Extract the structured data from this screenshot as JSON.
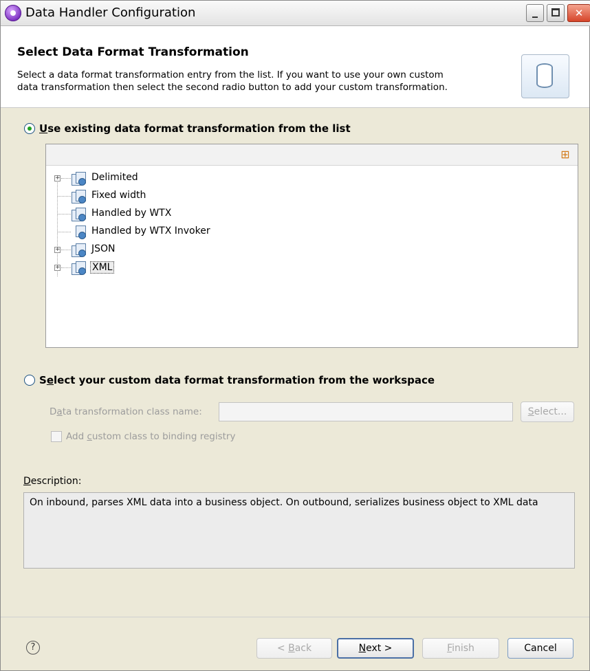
{
  "window": {
    "title": "Data Handler Configuration",
    "icon": "app-icon",
    "controls": {
      "minimize": "minimize-icon",
      "maximize": "maximize-icon",
      "close": "close-icon"
    }
  },
  "header": {
    "title": "Select Data Format Transformation",
    "description_line1": "Select a data format transformation entry from the list.  If you want to use your own custom",
    "description_line2": "data transformation then select the second radio button to add your custom transformation."
  },
  "option_existing": {
    "label_mnemonic": "U",
    "label_rest": "se existing data format transformation from the list",
    "selected": true
  },
  "tree": {
    "toolbar_icon": "grid-icon",
    "items": [
      {
        "label": "Delimited",
        "expandable": true
      },
      {
        "label": "Fixed width",
        "expandable": false
      },
      {
        "label": "Handled by WTX",
        "expandable": false
      },
      {
        "label": "Handled by WTX Invoker",
        "expandable": false
      },
      {
        "label": "JSON",
        "expandable": true
      },
      {
        "label": "XML",
        "expandable": true,
        "selected": true
      }
    ]
  },
  "option_custom": {
    "label_pre": "S",
    "label_mnemonic": "e",
    "label_rest": "lect your custom data format transformation from the workspace",
    "selected": false,
    "class_label_pre": "D",
    "class_label_mnemonic": "a",
    "class_label_rest": "ta transformation class name:",
    "class_value": "",
    "select_mnemonic": "S",
    "select_rest": "elect...",
    "checkbox_pre": "Add ",
    "checkbox_mnemonic": "c",
    "checkbox_rest": "ustom class to binding registry"
  },
  "description": {
    "label_mnemonic": "D",
    "label_rest": "escription:",
    "text": "On inbound, parses XML data into a business object. On outbound, serializes business object to XML data"
  },
  "footer": {
    "help_icon": "help-icon",
    "help_glyph": "?",
    "back_pre": "< ",
    "back_mnemonic": "B",
    "back_rest": "ack",
    "next_mnemonic": "N",
    "next_rest": "ext >",
    "finish_mnemonic": "F",
    "finish_rest": "inish",
    "cancel": "Cancel"
  }
}
